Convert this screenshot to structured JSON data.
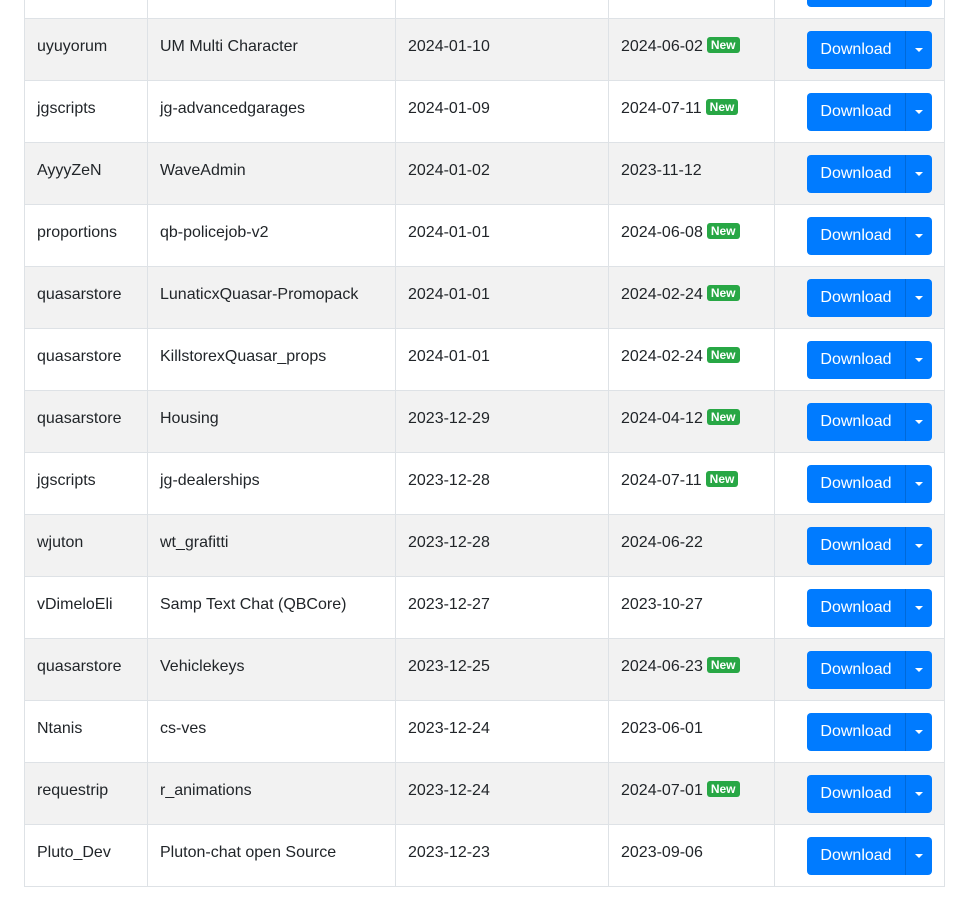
{
  "download_label": "Download",
  "new_label": "New",
  "rows": [
    {
      "author": "",
      "name": "",
      "created": "",
      "updated": "",
      "is_new": false
    },
    {
      "author": "uyuyorum",
      "name": "UM Multi Character",
      "created": "2024-01-10",
      "updated": "2024-06-02",
      "is_new": true
    },
    {
      "author": "jgscripts",
      "name": "jg-advancedgarages",
      "created": "2024-01-09",
      "updated": "2024-07-11",
      "is_new": true
    },
    {
      "author": "AyyyZeN",
      "name": "WaveAdmin",
      "created": "2024-01-02",
      "updated": "2023-11-12",
      "is_new": false
    },
    {
      "author": "proportions",
      "name": "qb-policejob-v2",
      "created": "2024-01-01",
      "updated": "2024-06-08",
      "is_new": true
    },
    {
      "author": "quasarstore",
      "name": "LunaticxQuasar-Promopack",
      "created": "2024-01-01",
      "updated": "2024-02-24",
      "is_new": true
    },
    {
      "author": "quasarstore",
      "name": "KillstorexQuasar_props",
      "created": "2024-01-01",
      "updated": "2024-02-24",
      "is_new": true
    },
    {
      "author": "quasarstore",
      "name": "Housing",
      "created": "2023-12-29",
      "updated": "2024-04-12",
      "is_new": true
    },
    {
      "author": "jgscripts",
      "name": "jg-dealerships",
      "created": "2023-12-28",
      "updated": "2024-07-11",
      "is_new": true
    },
    {
      "author": "wjuton",
      "name": "wt_grafitti",
      "created": "2023-12-28",
      "updated": "2024-06-22",
      "is_new": false
    },
    {
      "author": "vDimeloEli",
      "name": "Samp Text Chat (QBCore)",
      "created": "2023-12-27",
      "updated": "2023-10-27",
      "is_new": false
    },
    {
      "author": "quasarstore",
      "name": "Vehiclekeys",
      "created": "2023-12-25",
      "updated": "2024-06-23",
      "is_new": true
    },
    {
      "author": "Ntanis",
      "name": "cs-ves",
      "created": "2023-12-24",
      "updated": "2023-06-01",
      "is_new": false
    },
    {
      "author": "requestrip",
      "name": "r_animations",
      "created": "2023-12-24",
      "updated": "2024-07-01",
      "is_new": true
    },
    {
      "author": "Pluto_Dev",
      "name": "Pluton-chat open Source",
      "created": "2023-12-23",
      "updated": "2023-09-06",
      "is_new": false
    }
  ],
  "colors": {
    "primary": "#007bff",
    "badge_success": "#28a745",
    "stripe": "#f2f2f2",
    "border": "#dee2e6"
  }
}
